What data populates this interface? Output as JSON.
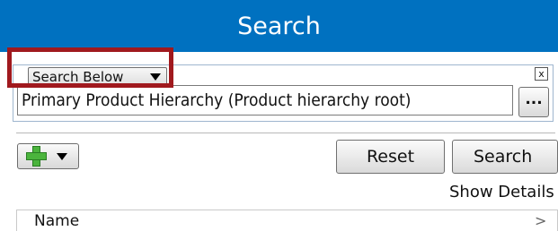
{
  "header": {
    "title": "Search"
  },
  "scope": {
    "selected": "Search Below",
    "close_glyph": "x",
    "hierarchy_value": "Primary Product Hierarchy (Product hierarchy root)",
    "browse_label": "..."
  },
  "toolbar": {
    "add_icon": "plus-icon",
    "reset_label": "Reset",
    "search_label": "Search",
    "show_details_label": "Show Details"
  },
  "results": {
    "columns": [
      "Name"
    ],
    "sort_glyph": ">"
  },
  "colors": {
    "header_bg": "#0071c0",
    "highlight": "#a0191e",
    "add_icon": "#4bb43d"
  }
}
